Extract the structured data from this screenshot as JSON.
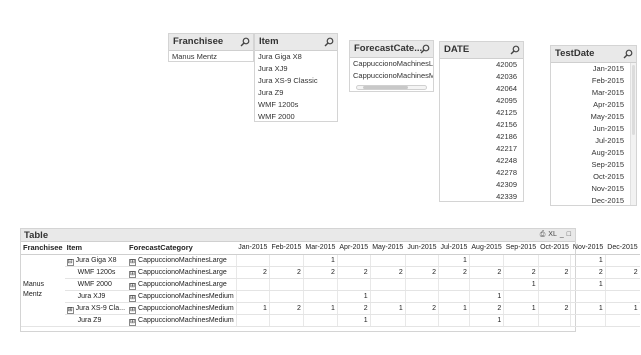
{
  "listboxes": {
    "franchisee": {
      "title": "Franchisee",
      "items": [
        "Manus Mentz"
      ]
    },
    "item": {
      "title": "Item",
      "items": [
        "Jura Giga X8",
        "Jura XJ9",
        "Jura XS-9 Classic",
        "Jura Z9",
        "WMF 1200s",
        "WMF 2000"
      ]
    },
    "forecast_category": {
      "title": "ForecastCate...",
      "items": [
        "CappuccionoMachinesLarge",
        "CappuccionoMachinesMedium"
      ]
    },
    "date": {
      "title": "DATE",
      "items": [
        "42005",
        "42036",
        "42064",
        "42095",
        "42125",
        "42156",
        "42186",
        "42217",
        "42248",
        "42278",
        "42309",
        "42339"
      ]
    },
    "test_date": {
      "title": "TestDate",
      "items": [
        "Jan-2015",
        "Feb-2015",
        "Mar-2015",
        "Apr-2015",
        "May-2015",
        "Jun-2015",
        "Jul-2015",
        "Aug-2015",
        "Sep-2015",
        "Oct-2015",
        "Nov-2015",
        "Dec-2015"
      ]
    }
  },
  "table": {
    "title": "Table",
    "toolbar": {
      "print": "⎙",
      "xl": "XL",
      "minimize": "_",
      "maximize": "□"
    },
    "headers": {
      "franchisee": "Franchisee",
      "item": "Item",
      "category": "ForecastCategory"
    },
    "months": [
      "Jan-2015",
      "Feb-2015",
      "Mar-2015",
      "Apr-2015",
      "May-2015",
      "Jun-2015",
      "Jul-2015",
      "Aug-2015",
      "Sep-2015",
      "Oct-2015",
      "Nov-2015",
      "Dec-2015"
    ],
    "franchisee_value": "Manus Mentz",
    "rows": [
      {
        "item": "Jura Giga X8",
        "expander": "⊟",
        "cat_expander": "⊞",
        "category": "CappuccionoMachinesLarge",
        "values": [
          "",
          "",
          "1",
          "",
          "",
          "",
          "1",
          "",
          "",
          "",
          "1",
          ""
        ]
      },
      {
        "item": "WMF 1200s",
        "expander": "",
        "cat_expander": "⊞",
        "category": "CappuccionoMachinesLarge",
        "values": [
          "2",
          "2",
          "2",
          "2",
          "2",
          "2",
          "2",
          "2",
          "2",
          "2",
          "2",
          "2"
        ]
      },
      {
        "item": "WMF 2000",
        "expander": "",
        "cat_expander": "⊞",
        "category": "CappuccionoMachinesLarge",
        "values": [
          "",
          "",
          "",
          "",
          "",
          "",
          "",
          "",
          "1",
          "",
          "1",
          ""
        ]
      },
      {
        "item": "Jura XJ9",
        "expander": "",
        "cat_expander": "⊞",
        "category": "CappuccionoMachinesMedium",
        "values": [
          "",
          "",
          "",
          "1",
          "",
          "",
          "",
          "1",
          "",
          "",
          "",
          ""
        ]
      },
      {
        "item": "Jura XS-9 Cla...",
        "expander": "⊞",
        "cat_expander": "⊞",
        "category": "CappuccionoMachinesMedium",
        "values": [
          "1",
          "2",
          "1",
          "2",
          "1",
          "2",
          "1",
          "2",
          "1",
          "2",
          "1",
          "1"
        ]
      },
      {
        "item": "Jura Z9",
        "expander": "",
        "cat_expander": "⊞",
        "category": "CappuccionoMachinesMedium",
        "values": [
          "",
          "",
          "",
          "1",
          "",
          "",
          "",
          "1",
          "",
          "",
          "",
          ""
        ]
      }
    ]
  },
  "icons": {
    "search": "search-icon"
  }
}
